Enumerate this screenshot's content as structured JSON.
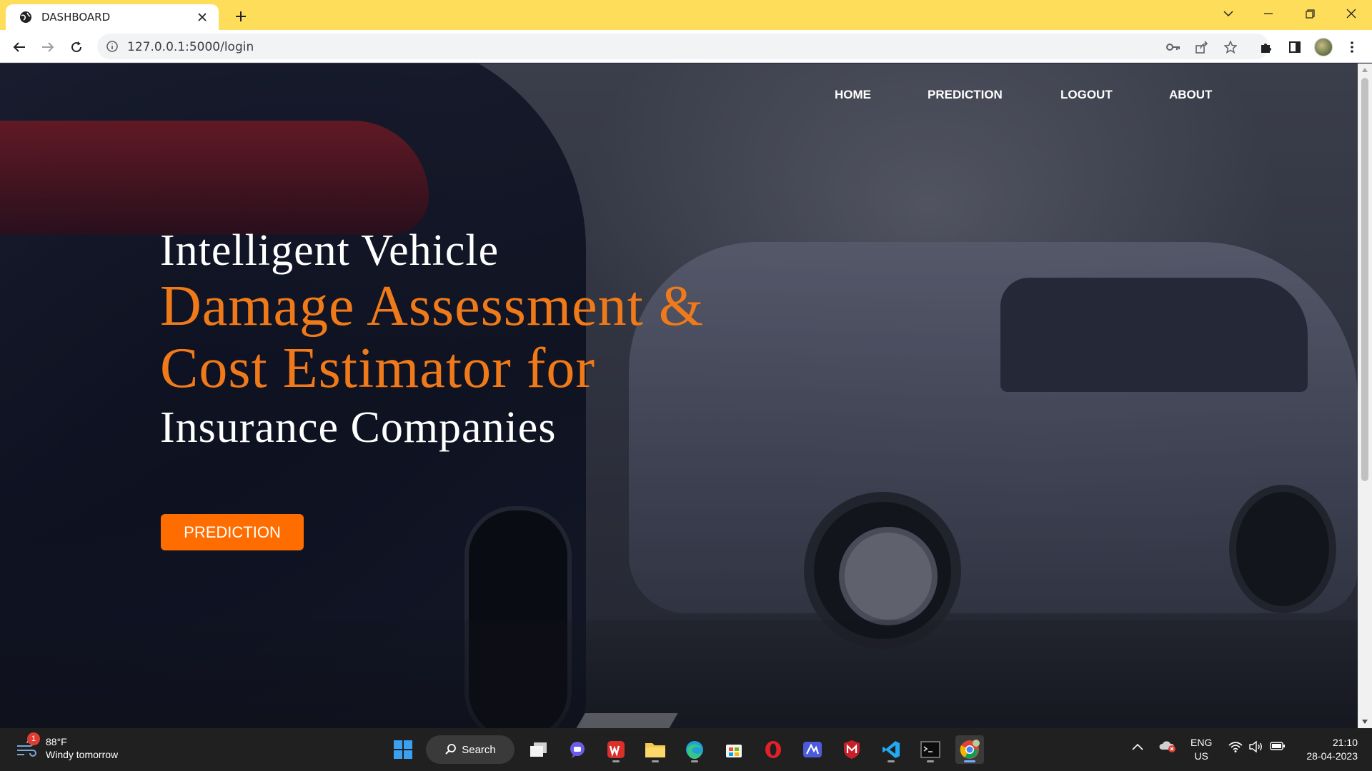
{
  "browser": {
    "tab_title": "DASHBOARD",
    "url": "127.0.0.1:5000/login"
  },
  "nav": {
    "home": "HOME",
    "prediction": "PREDICTION",
    "logout": "LOGOUT",
    "about": "ABOUT"
  },
  "hero": {
    "line1": "Intelligent Vehicle",
    "line2": "Damage Assessment &",
    "line3": "Cost Estimator for",
    "line4": "Insurance Companies",
    "cta_label": "PREDICTION"
  },
  "taskbar": {
    "weather_badge": "1",
    "temperature": "88°F",
    "forecast": "Windy tomorrow",
    "search_label": "Search",
    "lang_top": "ENG",
    "lang_bottom": "US",
    "time": "21:10",
    "date": "28-04-2023"
  },
  "colors": {
    "browser_frame": "#fedd5a",
    "accent_orange": "#f07a1a",
    "button_orange": "#ff6d00"
  }
}
